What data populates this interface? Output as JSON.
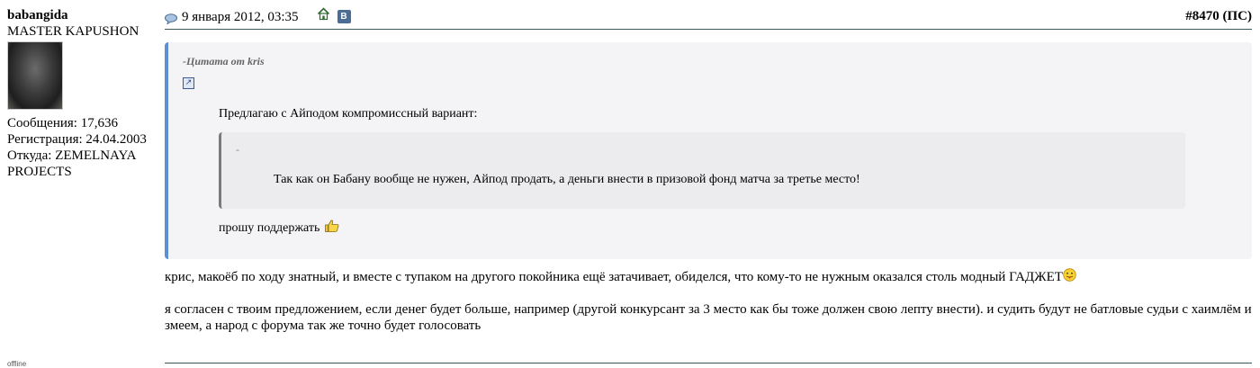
{
  "user": {
    "name": "babangida",
    "title": "MASTER KAPUSHON",
    "posts": "Сообщения: 17,636",
    "registered": "Регистрация: 24.04.2003",
    "from_label": "Откуда: ZEMELNAYA",
    "from_label_2": "PROJECTS",
    "status": "offline"
  },
  "post": {
    "date": "9 января 2012, 03:35",
    "number": "#8470",
    "class_label": "(ПС)"
  },
  "quote": {
    "title": "-Цитата от kris",
    "body_intro": "Предлагаю с Айподом компромиссный вариант:",
    "inner_title": "-",
    "inner_text": "Так как он Бабану вообще не нужен, Айпод продать, а деньги внести в призовой фонд матча за третье место!",
    "after": "прошу поддержать"
  },
  "message": {
    "p1": "крис, макоёб по ходу знатный, и вместе с тупаком на другого покойника ещё затачивает, обиделся, что кому-то не нужным оказался столь модный ГАДЖЕТ",
    "p2": "я согласен с твоим предложением, если денег будет больше, например (другой конкурсант за 3 место как бы тоже должен свою лепту внести). и судить будут не батловые судьи с хаимлём и змеем, а народ с форума так же точно будет голосовать"
  },
  "icons": {
    "post": "post-icon",
    "home": "home-icon",
    "vk": "vk-icon",
    "vk_letter": "B",
    "quote_link": "link-icon",
    "thumb_smiley": "thumbs-up-smiley",
    "tongue_smiley": "tongue-smiley"
  },
  "colors": {
    "quote_border": "#5b8fd6",
    "rule": "#3c5a5a",
    "vk": "#4a6c95"
  }
}
